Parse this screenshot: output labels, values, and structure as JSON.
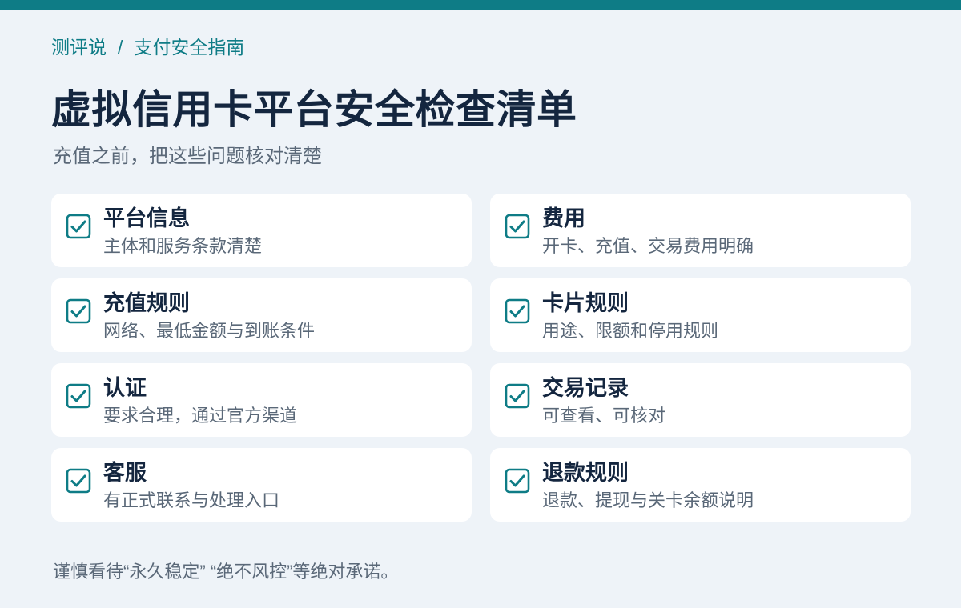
{
  "colors": {
    "accent": "#0e7c86",
    "title": "#14263f",
    "muted": "#5a6878",
    "background": "#eef3f8",
    "card": "#ffffff"
  },
  "breadcrumb": {
    "root": "测评说",
    "separator": "/",
    "current": "支付安全指南"
  },
  "header": {
    "title": "虚拟信用卡平台安全检查清单",
    "subtitle": "充值之前，把这些问题核对清楚"
  },
  "checklist": [
    {
      "title": "平台信息",
      "desc": "主体和服务条款清楚",
      "checked": true,
      "icon": "checkbox-checked-icon"
    },
    {
      "title": "费用",
      "desc": "开卡、充值、交易费用明确",
      "checked": true,
      "icon": "checkbox-checked-icon"
    },
    {
      "title": "充值规则",
      "desc": "网络、最低金额与到账条件",
      "checked": true,
      "icon": "checkbox-checked-icon"
    },
    {
      "title": "卡片规则",
      "desc": "用途、限额和停用规则",
      "checked": true,
      "icon": "checkbox-checked-icon"
    },
    {
      "title": "认证",
      "desc": "要求合理，通过官方渠道",
      "checked": true,
      "icon": "checkbox-checked-icon"
    },
    {
      "title": "交易记录",
      "desc": "可查看、可核对",
      "checked": true,
      "icon": "checkbox-checked-icon"
    },
    {
      "title": "客服",
      "desc": "有正式联系与处理入口",
      "checked": true,
      "icon": "checkbox-checked-icon"
    },
    {
      "title": "退款规则",
      "desc": "退款、提现与关卡余额说明",
      "checked": true,
      "icon": "checkbox-checked-icon"
    }
  ],
  "footer": {
    "note": "谨慎看待“永久稳定” “绝不风控”等绝对承诺。"
  }
}
